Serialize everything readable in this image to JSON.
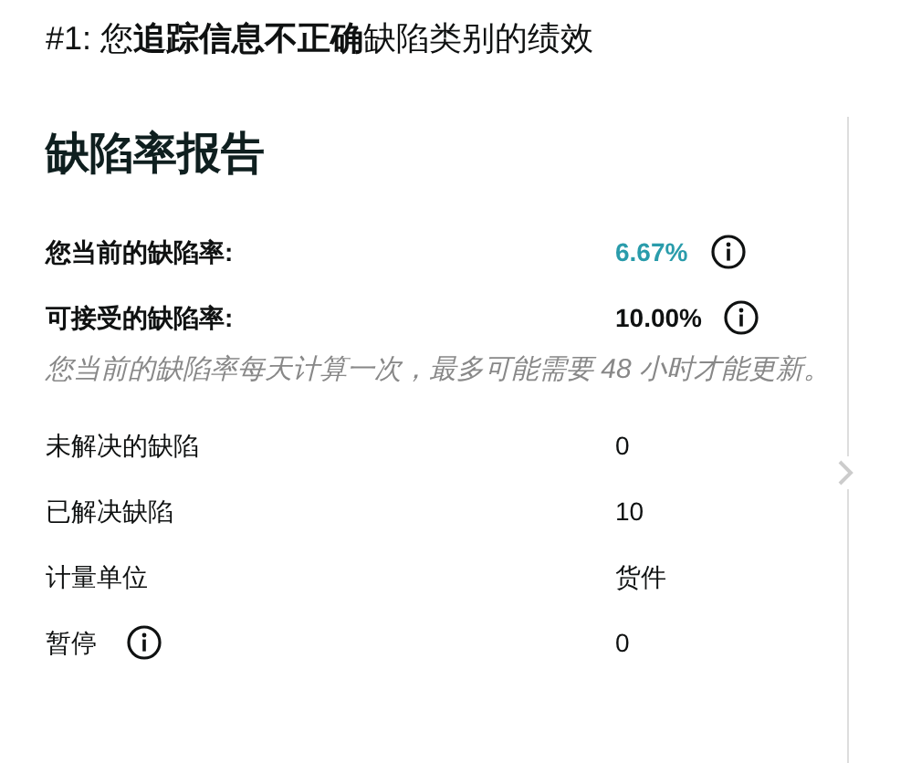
{
  "title": "#1: 您**追踪信息不正确**缺陷类别的绩效",
  "report": {
    "heading": "缺陷率报告",
    "rates": [
      {
        "label": "您当前的缺陷率:",
        "value": "6.67%",
        "highlighted": true,
        "has_info": true
      },
      {
        "label": "可接受的缺陷率:",
        "value": "10.00%",
        "highlighted": false,
        "has_info": true
      }
    ],
    "note": "您当前的缺陷率每天计算一次，最多可能需要 48 小时才能更新。",
    "stats": [
      {
        "label": "未解决的缺陷",
        "value": "0",
        "has_info": false
      },
      {
        "label": "已解决缺陷",
        "value": "10",
        "has_info": false
      },
      {
        "label": "计量单位",
        "value": "货件",
        "has_info": false
      },
      {
        "label": "暂停",
        "value": "0",
        "has_info": true
      }
    ]
  }
}
